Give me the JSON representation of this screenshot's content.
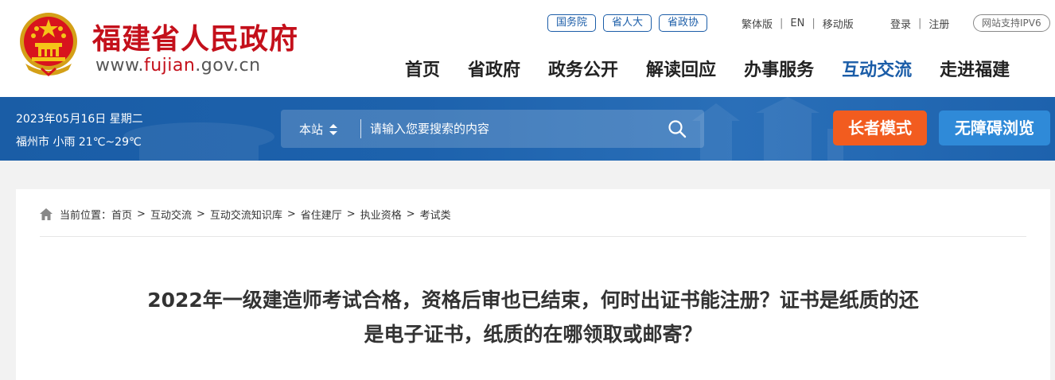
{
  "header": {
    "site_name": "福建省人民政府",
    "site_url_prefix": "www.",
    "site_url_accent": "fujian",
    "site_url_suffix": ".gov.cn",
    "org_links": [
      "国务院",
      "省人大",
      "省政协"
    ],
    "lang_links": [
      "繁体版",
      "EN",
      "移动版"
    ],
    "account_links": [
      "登录",
      "注册"
    ],
    "ipv6_badge": "网站支持IPV6",
    "nav": [
      "首页",
      "省政府",
      "政务公开",
      "解读回应",
      "办事服务",
      "互动交流",
      "走进福建"
    ],
    "active_nav": "互动交流"
  },
  "infobar": {
    "date": "2023年05月16日 星期二",
    "weather": "福州市 小雨 21℃~29℃",
    "search_scope": "本站",
    "search_placeholder": "请输入您要搜索的内容",
    "elder_mode_label": "长者模式",
    "accessibility_label": "无障碍浏览"
  },
  "breadcrumb": {
    "prefix": "当前位置：",
    "items": [
      "首页",
      "互动交流",
      "互动交流知识库",
      "省住建厅",
      "执业资格",
      "考试类"
    ]
  },
  "article": {
    "title_line1": "2022年一级建造师考试合格，资格后审也已结束，何时出证书能注册？证书是纸质的还",
    "title_line2": "是电子证书，纸质的在哪领取或邮寄？"
  },
  "colors": {
    "brand_red": "#c4101b",
    "nav_active_blue": "#1b5da8",
    "bar_blue": "#1d62ad",
    "elder_orange": "#f25c1f",
    "access_blue": "#2f8ad8"
  }
}
